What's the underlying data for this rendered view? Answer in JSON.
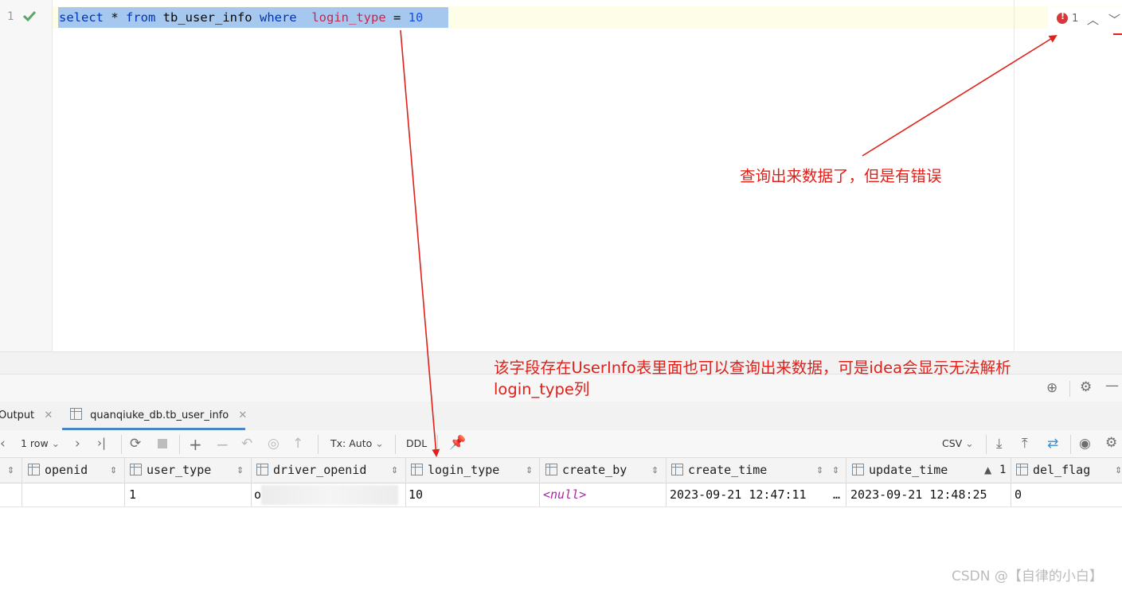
{
  "editor": {
    "line_number": "1",
    "sql": {
      "select": "select",
      "star": " * ",
      "from": "from",
      "table": " tb_user_info ",
      "where": "where",
      "gap": "  ",
      "column": "login_type",
      "eq": " = ",
      "value": "10"
    },
    "error_count": "1"
  },
  "tabs": [
    {
      "label": "Output"
    },
    {
      "label": "quanqiuke_db.tb_user_info"
    }
  ],
  "toolbar": {
    "row_count": "1 row",
    "tx_mode": "Tx: Auto",
    "ddl": "DDL",
    "export_format": "CSV"
  },
  "grid": {
    "columns": [
      "openid",
      "user_type",
      "driver_openid",
      "login_type",
      "create_by",
      "create_time",
      "update_time",
      "del_flag"
    ],
    "sort_index": "1",
    "row": {
      "user_type": "1",
      "driver_openid_prefix": "o",
      "login_type": "10",
      "create_by": "<null>",
      "create_time": "2023-09-21 12:47:11",
      "ellipsis": "…",
      "update_time": "2023-09-21 12:48:25",
      "del_flag": "0"
    }
  },
  "annotations": {
    "note1": "查询出来数据了，但是有错误",
    "note2_line1": "该字段存在UserInfo表里面也可以查询出来数据，可是idea会显示无法解析",
    "note2_line2": "login_type列"
  },
  "watermark": "CSDN @【自律的小白】",
  "colors": {
    "annotation": "#e0201a",
    "keyword": "#0033b3",
    "column": "#c7254e",
    "number": "#1750eb",
    "selection": "#a6c8ef",
    "null": "#a626a4"
  }
}
